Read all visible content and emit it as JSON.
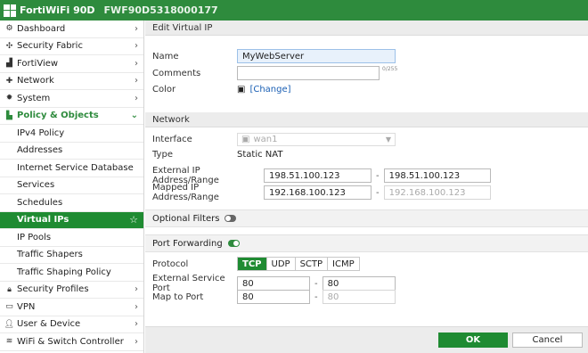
{
  "header": {
    "product": "FortiWiFi 90D",
    "serial": "FWF90D5318000177"
  },
  "sidebar": {
    "items": [
      {
        "label": "Dashboard",
        "icon": "dashboard-icon"
      },
      {
        "label": "Security Fabric",
        "icon": "fabric-icon"
      },
      {
        "label": "FortiView",
        "icon": "chart-icon"
      },
      {
        "label": "Network",
        "icon": "network-icon"
      },
      {
        "label": "System",
        "icon": "gear-icon"
      },
      {
        "label": "Policy & Objects",
        "icon": "policy-icon"
      }
    ],
    "sub_items": [
      {
        "label": "IPv4 Policy"
      },
      {
        "label": "Addresses"
      },
      {
        "label": "Internet Service Database"
      },
      {
        "label": "Services"
      },
      {
        "label": "Schedules"
      },
      {
        "label": "Virtual IPs"
      },
      {
        "label": "IP Pools"
      },
      {
        "label": "Traffic Shapers"
      },
      {
        "label": "Traffic Shaping Policy"
      }
    ],
    "bottom_items": [
      {
        "label": "Security Profiles",
        "icon": "lock-icon"
      },
      {
        "label": "VPN",
        "icon": "vpn-icon"
      },
      {
        "label": "User & Device",
        "icon": "user-icon"
      },
      {
        "label": "WiFi & Switch Controller",
        "icon": "wifi-icon"
      }
    ]
  },
  "form": {
    "title": "Edit Virtual IP",
    "name_label": "Name",
    "name_value": "MyWebServer",
    "comments_label": "Comments",
    "comments_counter": "0/255",
    "color_label": "Color",
    "color_link": "[Change]",
    "network_header": "Network",
    "interface_label": "Interface",
    "interface_value": "wan1",
    "type_label": "Type",
    "type_value": "Static NAT",
    "ext_ip_label": "External IP Address/Range",
    "ext_ip_start": "198.51.100.123",
    "ext_ip_end": "198.51.100.123",
    "mapped_ip_label": "Mapped IP Address/Range",
    "mapped_ip_start": "192.168.100.123",
    "mapped_ip_end": "192.168.100.123",
    "optional_filters_label": "Optional Filters",
    "optional_filters_on": false,
    "port_forwarding_label": "Port Forwarding",
    "port_forwarding_on": true,
    "protocol_label": "Protocol",
    "protocols": [
      "TCP",
      "UDP",
      "SCTP",
      "ICMP"
    ],
    "protocol_selected": "TCP",
    "ext_port_label": "External Service Port",
    "ext_port_start": "80",
    "ext_port_end": "80",
    "map_port_label": "Map to Port",
    "map_port_start": "80",
    "map_port_end": "80",
    "dash": "-"
  },
  "buttons": {
    "ok": "OK",
    "cancel": "Cancel"
  },
  "colors": {
    "brand_green": "#2e8b3d",
    "active_green": "#1f8b32",
    "link_blue": "#1a5fb4"
  }
}
